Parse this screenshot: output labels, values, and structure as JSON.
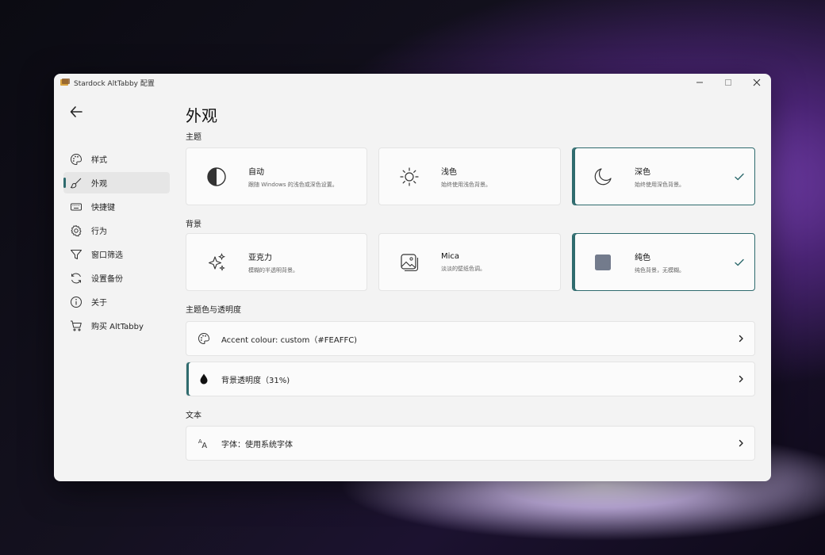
{
  "window": {
    "title": "Stardock AltTabby 配置"
  },
  "sidebar": {
    "items": [
      {
        "label": "样式",
        "icon": "palette-icon"
      },
      {
        "label": "外观",
        "icon": "brush-icon",
        "active": true
      },
      {
        "label": "快捷键",
        "icon": "keyboard-icon"
      },
      {
        "label": "行为",
        "icon": "gear-icon"
      },
      {
        "label": "窗口筛选",
        "icon": "filter-icon"
      },
      {
        "label": "设置备份",
        "icon": "sync-icon"
      },
      {
        "label": "关于",
        "icon": "info-icon"
      },
      {
        "label": "购买 AltTabby",
        "icon": "cart-icon"
      }
    ]
  },
  "main": {
    "page_title": "外观",
    "theme_section": "主题",
    "theme_cards": [
      {
        "title": "自动",
        "desc": "跟随 Windows 的浅色或深色设置。",
        "icon": "contrast-icon",
        "selected": false
      },
      {
        "title": "浅色",
        "desc": "始终使用浅色背景。",
        "icon": "sun-icon",
        "selected": false
      },
      {
        "title": "深色",
        "desc": "始终使用深色背景。",
        "icon": "moon-icon",
        "selected": true
      }
    ],
    "background_section": "背景",
    "background_cards": [
      {
        "title": "亚克力",
        "desc": "模糊的半透明背景。",
        "icon": "sparkle-icon",
        "selected": false
      },
      {
        "title": "Mica",
        "desc": "淡淡的壁纸色调。",
        "icon": "image-icon",
        "selected": false
      },
      {
        "title": "纯色",
        "desc": "纯色背景，无模糊。",
        "icon": "square-icon",
        "selected": true
      }
    ],
    "accent_section": "主题色与透明度",
    "accent_row": "Accent colour: custom（#FEAFFC)",
    "transparency_row": "背景透明度（31%)",
    "text_section": "文本",
    "font_row": "字体：使用系统字体"
  },
  "colors": {
    "accent": "#2f6b6e",
    "solid_swatch": "#737b8c"
  }
}
